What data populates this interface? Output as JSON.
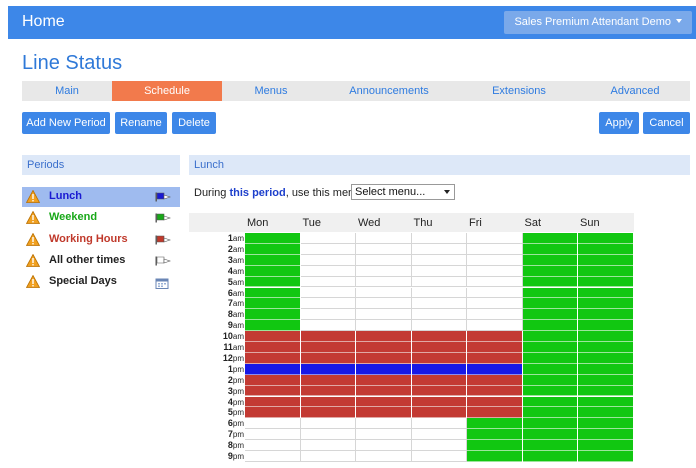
{
  "header": {
    "title": "Home",
    "account": "Sales Premium Attendant Demo"
  },
  "page_title": "Line Status",
  "tabs": [
    {
      "label": "Main",
      "active": false
    },
    {
      "label": "Schedule",
      "active": true
    },
    {
      "label": "Menus",
      "active": false
    },
    {
      "label": "Announcements",
      "active": false
    },
    {
      "label": "Extensions",
      "active": false
    },
    {
      "label": "Advanced",
      "active": false
    }
  ],
  "toolbar": {
    "add": "Add New Period",
    "rename": "Rename",
    "delete": "Delete",
    "apply": "Apply",
    "cancel": "Cancel"
  },
  "periods_panel": {
    "title": "Periods",
    "items": [
      {
        "name": "Lunch",
        "color": "#1919d2",
        "icon": "flag-icon",
        "selected": true
      },
      {
        "name": "Weekend",
        "color": "#18a818",
        "icon": "flag-icon",
        "selected": false
      },
      {
        "name": "Working Hours",
        "color": "#c0392b",
        "icon": "flag-icon",
        "selected": false
      },
      {
        "name": "All other times",
        "color": "#222222",
        "icon": "flag-icon",
        "selected": false
      },
      {
        "name": "Special Days",
        "color": "#222222",
        "icon": "calendar-icon",
        "selected": false
      }
    ]
  },
  "schedule_panel": {
    "title": "Lunch",
    "during_prefix": "During ",
    "during_link": "this period",
    "during_suffix": ", use this menu:",
    "menu_select": "Select menu..."
  },
  "days": [
    "Mon",
    "Tue",
    "Wed",
    "Thu",
    "Fri",
    "Sat",
    "Sun"
  ],
  "hours": [
    {
      "n": "1",
      "u": "am"
    },
    {
      "n": "2",
      "u": "am"
    },
    {
      "n": "3",
      "u": "am"
    },
    {
      "n": "4",
      "u": "am"
    },
    {
      "n": "5",
      "u": "am"
    },
    {
      "n": "6",
      "u": "am"
    },
    {
      "n": "7",
      "u": "am"
    },
    {
      "n": "8",
      "u": "am"
    },
    {
      "n": "9",
      "u": "am"
    },
    {
      "n": "10",
      "u": "am"
    },
    {
      "n": "11",
      "u": "am"
    },
    {
      "n": "12",
      "u": "pm"
    },
    {
      "n": "1",
      "u": "pm"
    },
    {
      "n": "2",
      "u": "pm"
    },
    {
      "n": "3",
      "u": "pm"
    },
    {
      "n": "4",
      "u": "pm"
    },
    {
      "n": "5",
      "u": "pm"
    },
    {
      "n": "6",
      "u": "pm"
    },
    {
      "n": "7",
      "u": "pm"
    },
    {
      "n": "8",
      "u": "pm"
    },
    {
      "n": "9",
      "u": "pm"
    }
  ],
  "grid": [
    [
      "G",
      "W",
      "W",
      "W",
      "W",
      "G",
      "G"
    ],
    [
      "G",
      "W",
      "W",
      "W",
      "W",
      "G",
      "G"
    ],
    [
      "G",
      "W",
      "W",
      "W",
      "W",
      "G",
      "G"
    ],
    [
      "G",
      "W",
      "W",
      "W",
      "W",
      "G",
      "G"
    ],
    [
      "G",
      "W",
      "W",
      "W",
      "W",
      "G",
      "G"
    ],
    [
      "G",
      "W",
      "W",
      "W",
      "W",
      "G",
      "G"
    ],
    [
      "G",
      "W",
      "W",
      "W",
      "W",
      "G",
      "G"
    ],
    [
      "G",
      "W",
      "W",
      "W",
      "W",
      "G",
      "G"
    ],
    [
      "G",
      "W",
      "W",
      "W",
      "W",
      "G",
      "G"
    ],
    [
      "R",
      "R",
      "R",
      "R",
      "R",
      "G",
      "G"
    ],
    [
      "R",
      "R",
      "R",
      "R",
      "R",
      "G",
      "G"
    ],
    [
      "R",
      "R",
      "R",
      "R",
      "R",
      "G",
      "G"
    ],
    [
      "B",
      "B",
      "B",
      "B",
      "B",
      "G",
      "G"
    ],
    [
      "R",
      "R",
      "R",
      "R",
      "R",
      "G",
      "G"
    ],
    [
      "R",
      "R",
      "R",
      "R",
      "R",
      "G",
      "G"
    ],
    [
      "R",
      "R",
      "R",
      "R",
      "R",
      "G",
      "G"
    ],
    [
      "R",
      "R",
      "R",
      "R",
      "R",
      "G",
      "G"
    ],
    [
      "W",
      "W",
      "W",
      "W",
      "G",
      "G",
      "G"
    ],
    [
      "W",
      "W",
      "W",
      "W",
      "G",
      "G",
      "G"
    ],
    [
      "W",
      "W",
      "W",
      "W",
      "G",
      "G",
      "G"
    ],
    [
      "W",
      "W",
      "W",
      "W",
      "G",
      "G",
      "G"
    ]
  ],
  "colors": {
    "G": "#11c711",
    "R": "#c33a33",
    "B": "#1818e6",
    "W": "#ffffff"
  }
}
